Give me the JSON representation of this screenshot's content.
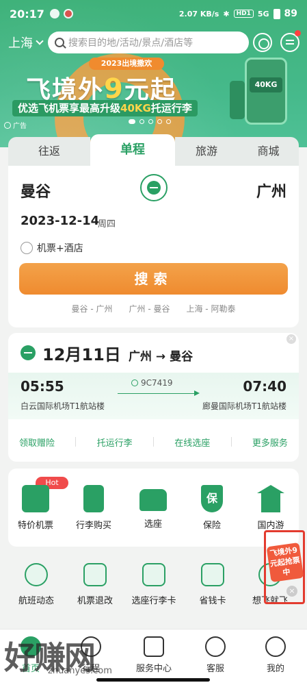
{
  "status": {
    "time": "20:17",
    "speed": "2.07 KB/s",
    "hd": "HD1",
    "signal": "5G",
    "battery": "89"
  },
  "header": {
    "city": "上海",
    "search_placeholder": "搜索目的地/活动/景点/酒店等"
  },
  "banner": {
    "small": "2023出境撒欢",
    "title_prefix": "飞境外",
    "title_num": "9",
    "title_suffix": "元起",
    "subtitle_prefix": "优选飞机票享最高升级",
    "subtitle_hl": "40KG",
    "subtitle_suffix": "托运行李",
    "luggage_tag": "40KG",
    "ad_label": "广告"
  },
  "booking": {
    "tabs": [
      "往返",
      "单程",
      "旅游",
      "商城"
    ],
    "from": "曼谷",
    "to": "广州",
    "date": "2023-12-14",
    "weekday": "周四",
    "combo_label": "机票+酒店",
    "search_label": "搜索",
    "history": [
      "曼谷 - 广州",
      "广州 - 曼谷",
      "上海 - 阿勒泰"
    ]
  },
  "trip": {
    "date": "12月11日",
    "route": "广州 → 曼谷",
    "flight_no": "9C7419",
    "dep_time": "05:55",
    "arr_time": "07:40",
    "dep_airport": "白云国际机场T1航站楼",
    "arr_airport": "廊曼国际机场T1航站楼",
    "actions": [
      "领取赠险",
      "托运行李",
      "在线选座",
      "更多服务"
    ],
    "close": "×"
  },
  "grid1": {
    "hot_badge": "Hot",
    "items": [
      "特价机票",
      "行李购买",
      "选座",
      "保险",
      "国内游"
    ],
    "shield_char": "保"
  },
  "grid2": {
    "items": [
      "航班动态",
      "机票退改",
      "选座行李卡",
      "省钱卡",
      "想飞就飞"
    ]
  },
  "float_ad": {
    "text": "飞境外9元起抢票中",
    "close": "×"
  },
  "tabbar": {
    "items": [
      "首页",
      "行程",
      "服务中心",
      "客服",
      "我的"
    ]
  },
  "watermark": {
    "text": "好赚网",
    "url": "zhuanyes.com"
  },
  "colors": {
    "brand_green": "#2aa064",
    "accent_orange": "#ef8b2f"
  }
}
